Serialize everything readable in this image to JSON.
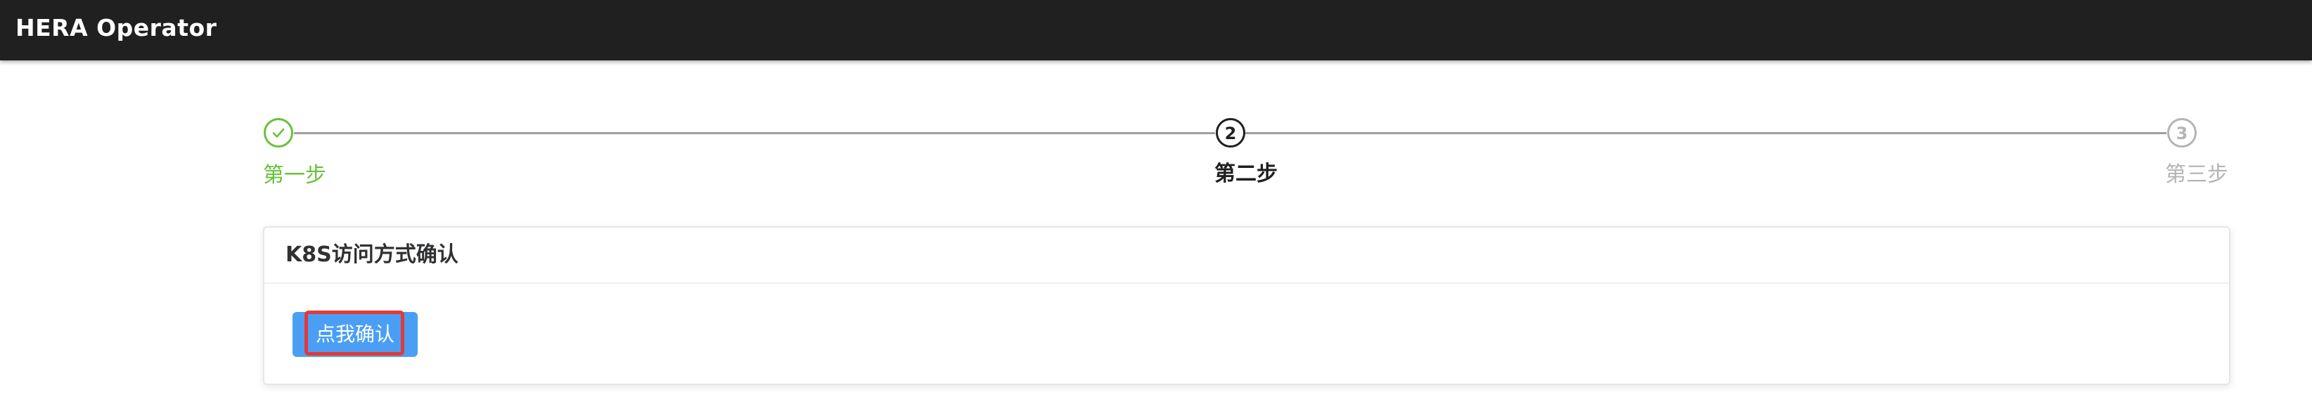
{
  "app": {
    "title": "HERA Operator"
  },
  "stepper": {
    "steps": [
      {
        "number": "1",
        "label": "第一步",
        "status": "done",
        "icon": "check-icon"
      },
      {
        "number": "2",
        "label": "第二步",
        "status": "active"
      },
      {
        "number": "3",
        "label": "第三步",
        "status": "wait"
      }
    ],
    "colors": {
      "done": "#67c23a",
      "active": "#1f1f1f",
      "wait": "#b4b4b4",
      "line": "#9e9e9e"
    }
  },
  "card": {
    "title": "K8S访问方式确认",
    "button_label": "点我确认",
    "button_color": "#4a9ff5",
    "highlight_color": "#e53935"
  }
}
